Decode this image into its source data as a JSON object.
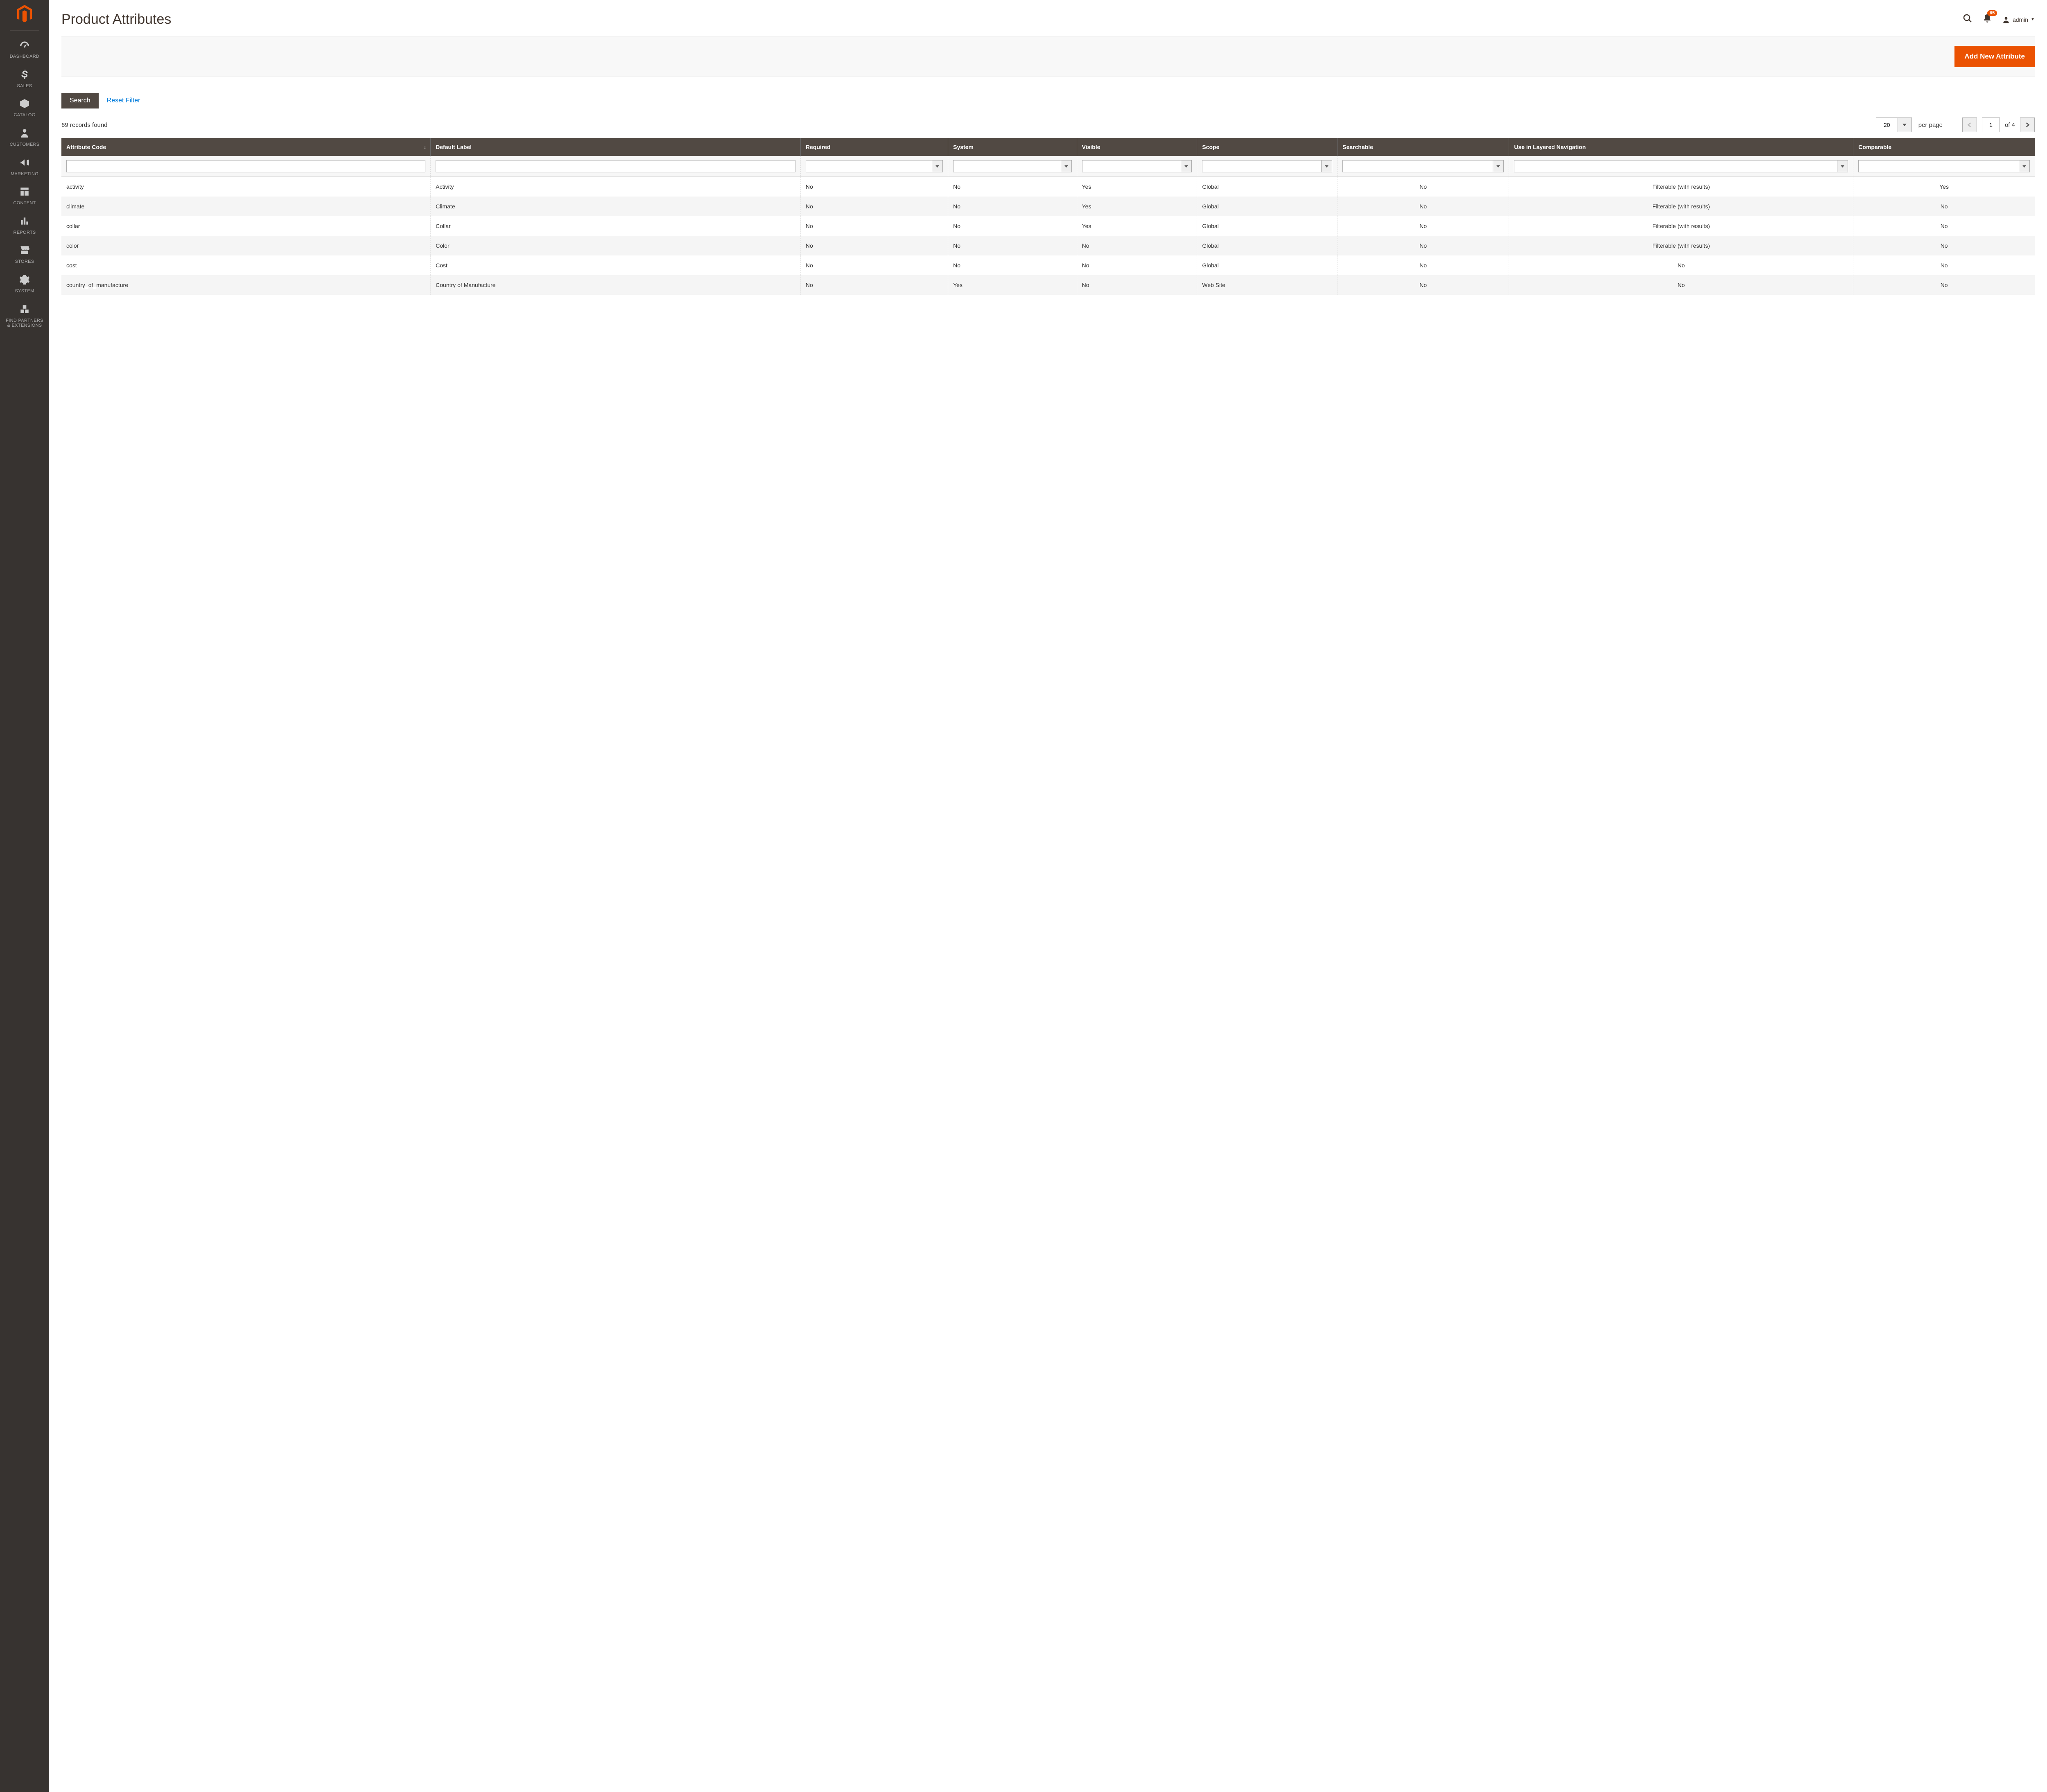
{
  "sidebar": {
    "items": [
      {
        "label": "DASHBOARD",
        "icon": "dashboard-icon"
      },
      {
        "label": "SALES",
        "icon": "dollar-icon"
      },
      {
        "label": "CATALOG",
        "icon": "box-icon"
      },
      {
        "label": "CUSTOMERS",
        "icon": "person-icon"
      },
      {
        "label": "MARKETING",
        "icon": "megaphone-icon"
      },
      {
        "label": "CONTENT",
        "icon": "layout-icon"
      },
      {
        "label": "REPORTS",
        "icon": "bars-icon"
      },
      {
        "label": "STORES",
        "icon": "storefront-icon"
      },
      {
        "label": "SYSTEM",
        "icon": "gear-icon"
      },
      {
        "label": "FIND PARTNERS\n& EXTENSIONS",
        "icon": "blocks-icon"
      }
    ]
  },
  "header": {
    "title": "Product Attributes",
    "notification_count": "65",
    "user_name": "admin"
  },
  "actions": {
    "add_label": "Add New Attribute",
    "search_label": "Search",
    "reset_label": "Reset Filter"
  },
  "records": {
    "found_text": "69 records found",
    "page_size": "20",
    "per_page_label": "per page",
    "current_page": "1",
    "of_label": "of 4"
  },
  "columns": [
    "Attribute Code",
    "Default Label",
    "Required",
    "System",
    "Visible",
    "Scope",
    "Searchable",
    "Use in Layered Navigation",
    "Comparable"
  ],
  "sort_indicator": "↓",
  "rows": [
    {
      "code": "activity",
      "label": "Activity",
      "required": "No",
      "system": "No",
      "visible": "Yes",
      "scope": "Global",
      "searchable": "No",
      "layered": "Filterable (with results)",
      "comparable": "Yes"
    },
    {
      "code": "climate",
      "label": "Climate",
      "required": "No",
      "system": "No",
      "visible": "Yes",
      "scope": "Global",
      "searchable": "No",
      "layered": "Filterable (with results)",
      "comparable": "No"
    },
    {
      "code": "collar",
      "label": "Collar",
      "required": "No",
      "system": "No",
      "visible": "Yes",
      "scope": "Global",
      "searchable": "No",
      "layered": "Filterable (with results)",
      "comparable": "No"
    },
    {
      "code": "color",
      "label": "Color",
      "required": "No",
      "system": "No",
      "visible": "No",
      "scope": "Global",
      "searchable": "No",
      "layered": "Filterable (with results)",
      "comparable": "No"
    },
    {
      "code": "cost",
      "label": "Cost",
      "required": "No",
      "system": "No",
      "visible": "No",
      "scope": "Global",
      "searchable": "No",
      "layered": "No",
      "comparable": "No"
    },
    {
      "code": "country_of_manufacture",
      "label": "Country of Manufacture",
      "required": "No",
      "system": "Yes",
      "visible": "No",
      "scope": "Web Site",
      "searchable": "No",
      "layered": "No",
      "comparable": "No"
    }
  ]
}
